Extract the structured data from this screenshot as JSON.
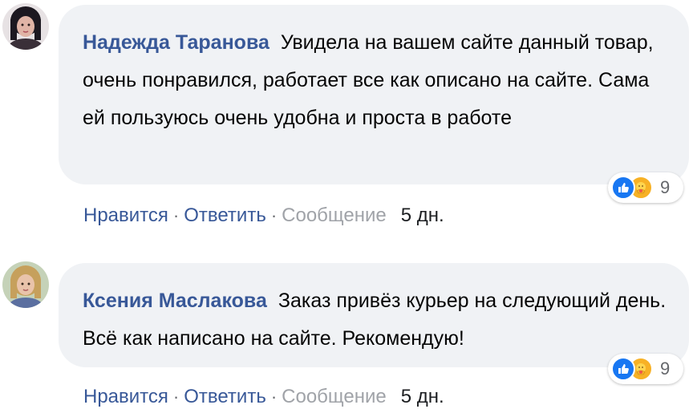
{
  "comments": [
    {
      "author": "Надежда Таранова",
      "text": "Увидела на вашем сайте данный товар, очень понравился, работает все как описано на сайте. Сама ей пользуюсь очень удобна и проста в работе",
      "reactions": {
        "icons": [
          "like-icon",
          "care-icon"
        ],
        "count": "9"
      },
      "actions": {
        "like": "Нравится",
        "reply": "Ответить",
        "message": "Сообщение",
        "time": "5 дн."
      },
      "avatar_colors": {
        "bg": "#e7e2e4",
        "hair": "#1c1820",
        "skin": "#e0b4a6"
      }
    },
    {
      "author": "Ксения Маслакова",
      "text": "Заказ привёз курьер на следующий день. Всё как написано на сайте. Рекомендую!",
      "reactions": {
        "icons": [
          "like-icon",
          "care-icon"
        ],
        "count": "9"
      },
      "actions": {
        "like": "Нравится",
        "reply": "Ответить",
        "message": "Сообщение",
        "time": "5 дн."
      },
      "avatar_colors": {
        "bg": "#c5d2b8",
        "hair": "#c6a05c",
        "skin": "#e9c3aa"
      }
    }
  ],
  "colors": {
    "author": "#385898",
    "bubble": "#f0f2f5",
    "link": "#385898",
    "muted": "#a0a3a8",
    "like": "#1877f2",
    "care": "#f7b125"
  }
}
